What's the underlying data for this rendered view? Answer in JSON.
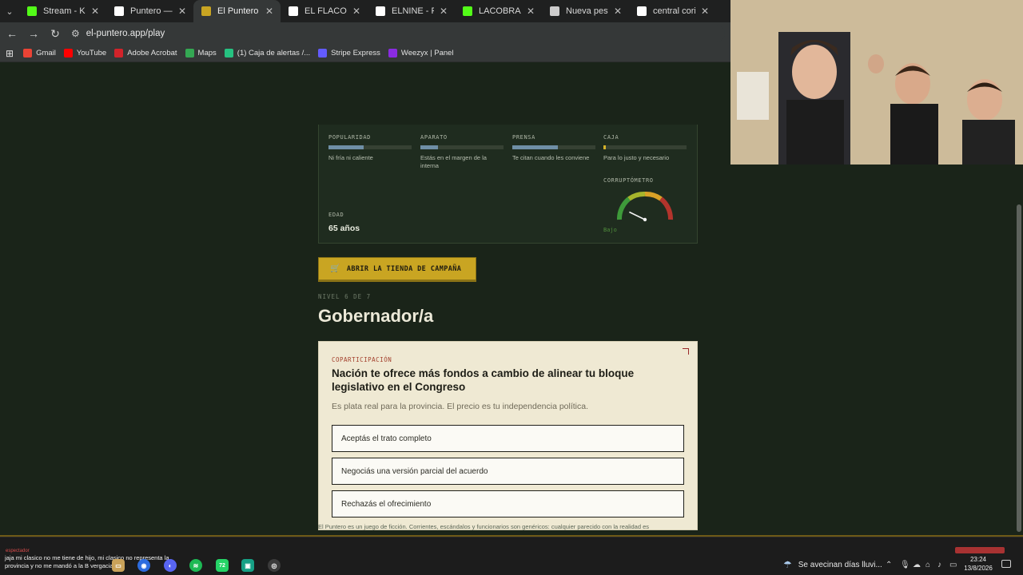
{
  "tabs": [
    {
      "title": "Stream - Kick Da",
      "icon": "kick-icon",
      "color": "#53fc18",
      "active": false
    },
    {
      "title": "Puntero — La cal",
      "icon": "p-icon",
      "color": "#ffffff",
      "active": false
    },
    {
      "title": "El Puntero — En",
      "icon": "puntero-icon",
      "color": "#c9a522",
      "active": true
    },
    {
      "title": "EL FLACO en X: '",
      "icon": "x-icon",
      "color": "#ffffff",
      "active": false
    },
    {
      "title": "ELNINE - Futbol",
      "icon": "nine-icon",
      "color": "#ffffff",
      "active": false
    },
    {
      "title": "LACOBRAAA Stre",
      "icon": "kick-icon",
      "color": "#53fc18",
      "active": false
    },
    {
      "title": "Nueva pestaña",
      "icon": "chrome-icon",
      "color": "#cccccc",
      "active": false
    },
    {
      "title": "central corinthian",
      "icon": "google-icon",
      "color": "#ffffff",
      "active": false
    }
  ],
  "address": {
    "url": "el-puntero.app/play"
  },
  "bookmarks": [
    {
      "label": "Gmail",
      "icon": "gmail-icon",
      "color": "#ea4335"
    },
    {
      "label": "YouTube",
      "icon": "youtube-icon",
      "color": "#ff0000"
    },
    {
      "label": "Adobe Acrobat",
      "icon": "acrobat-icon",
      "color": "#d2232a"
    },
    {
      "label": "Maps",
      "icon": "maps-icon",
      "color": "#34a853"
    },
    {
      "label": "(1) Caja de alertas /...",
      "icon": "alerts-icon",
      "color": "#26c281"
    },
    {
      "label": "Stripe Express",
      "icon": "stripe-icon",
      "color": "#635bff"
    },
    {
      "label": "Weezyx | Panel",
      "icon": "weezyx-icon",
      "color": "#8a2be2"
    }
  ],
  "stats": [
    {
      "label": "POPULARIDAD",
      "fill": 0.42,
      "color": "#6f8fa6",
      "desc": "Ni fría ni caliente"
    },
    {
      "label": "APARATO",
      "fill": 0.21,
      "color": "#6f8fa6",
      "desc": "Estás en el margen de la interna"
    },
    {
      "label": "PRENSA",
      "fill": 0.55,
      "color": "#6f8fa6",
      "desc": "Te citan cuando les conviene"
    },
    {
      "label": "CAJA",
      "fill": 0.03,
      "color": "#d4b22a",
      "desc": "Para lo justo y necesario"
    }
  ],
  "edad": {
    "label": "EDAD",
    "value": "65 años"
  },
  "corruptometro": {
    "label": "CORRUPTÓMETRO",
    "value": "Bajo",
    "level": 0.15
  },
  "shop": {
    "label": "ABRIR LA TIENDA DE CAMPAÑA"
  },
  "level": {
    "nivel": "NIVEL 6 DE 7",
    "title": "Gobernador/a"
  },
  "event": {
    "tag": "COPARTICIPACIÓN",
    "title": "Nación te ofrece más fondos a cambio de alinear tu bloque legislativo en el Congreso",
    "desc": "Es plata real para la provincia. El precio es tu independencia política.",
    "options": [
      "Aceptás el trato completo",
      "Negociás una versión parcial del acuerdo",
      "Rechazás el ofrecimiento"
    ]
  },
  "disclaimer": "El Puntero es un juego de ficción. Corrientes, escándalos y funcionarios son genéricos: cualquier parecido con la realidad es",
  "chat": {
    "user": "espectador",
    "message": "jaja mi clasico no me tiene de hijo, mi clasico no representa la provincia y no me mandó a la B vergacia"
  },
  "taskbar": {
    "whatsapp_badge": "72",
    "weather": "Se avecinan días lluvi...",
    "time": "23:24",
    "date": "13/8/2026"
  }
}
